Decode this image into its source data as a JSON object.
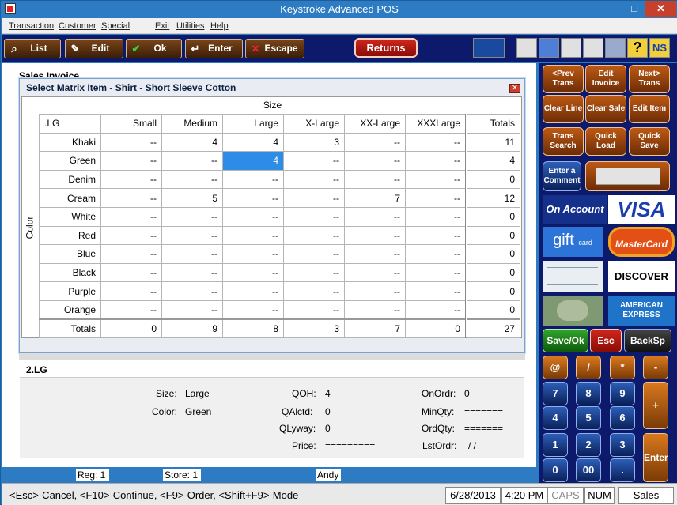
{
  "window": {
    "title": "Keystroke Advanced POS",
    "min": "–",
    "max": "□",
    "close": "✕"
  },
  "menu": [
    "Transaction",
    "Customer",
    "Special",
    "Exit",
    "Utilities",
    "Help"
  ],
  "toolbar": {
    "list": "List",
    "edit": "Edit",
    "ok": "Ok",
    "enter": "Enter",
    "escape": "Escape",
    "returns": "Returns",
    "help": "?",
    "ns": "NS"
  },
  "invoice_label": "Sales Invoice",
  "dialog": {
    "title": "Select Matrix Item - Shirt - Short Sleeve Cotton",
    "close": "✕",
    "size_header": "Size",
    "color_header": "Color",
    "corner": ".LG",
    "columns": [
      "Small",
      "Medium",
      "Large",
      "X-Large",
      "XX-Large",
      "XXXLarge",
      "Totals"
    ],
    "rows": [
      {
        "color": "Khaki",
        "cells": [
          "--",
          "4",
          "4",
          "3",
          "--",
          "--"
        ],
        "total": "11"
      },
      {
        "color": "Green",
        "cells": [
          "--",
          "--",
          "4",
          "--",
          "--",
          "--"
        ],
        "total": "4"
      },
      {
        "color": "Denim",
        "cells": [
          "--",
          "--",
          "--",
          "--",
          "--",
          "--"
        ],
        "total": "0"
      },
      {
        "color": "Cream",
        "cells": [
          "--",
          "5",
          "--",
          "--",
          "7",
          "--"
        ],
        "total": "12"
      },
      {
        "color": "White",
        "cells": [
          "--",
          "--",
          "--",
          "--",
          "--",
          "--"
        ],
        "total": "0"
      },
      {
        "color": "Red",
        "cells": [
          "--",
          "--",
          "--",
          "--",
          "--",
          "--"
        ],
        "total": "0"
      },
      {
        "color": "Blue",
        "cells": [
          "--",
          "--",
          "--",
          "--",
          "--",
          "--"
        ],
        "total": "0"
      },
      {
        "color": "Black",
        "cells": [
          "--",
          "--",
          "--",
          "--",
          "--",
          "--"
        ],
        "total": "0"
      },
      {
        "color": "Purple",
        "cells": [
          "--",
          "--",
          "--",
          "--",
          "--",
          "--"
        ],
        "total": "0"
      },
      {
        "color": "Orange",
        "cells": [
          "--",
          "--",
          "--",
          "--",
          "--",
          "--"
        ],
        "total": "0"
      }
    ],
    "totals_label": "Totals",
    "totals": [
      "0",
      "9",
      "8",
      "3",
      "7",
      "0",
      "27"
    ],
    "selected_cell": {
      "row": "Green",
      "column": "Large"
    }
  },
  "item_code": "2.LG",
  "details": {
    "size_label": "Size:",
    "size": "Large",
    "color_label": "Color:",
    "color": "Green",
    "qoh_label": "QOH:",
    "qoh": "4",
    "qalctd_label": "QAlctd:",
    "qalctd": "0",
    "qlyway_label": "QLyway:",
    "qlyway": "0",
    "price_label": "Price:",
    "price": "=========",
    "onordr_label": "OnOrdr:",
    "onordr": "0",
    "minqty_label": "MinQty:",
    "minqty": "=======",
    "ordqty_label": "OrdQty:",
    "ordqty": "=======",
    "lstordr_label": "LstOrdr:",
    "lstordr": "/ /"
  },
  "statusbar": {
    "reg": "Reg: 1",
    "store": "Store: 1",
    "user": "Andy"
  },
  "hint": "<Esc>-Cancel, <F10>-Continue, <F9>-Order, <Shift+F9>-Mode",
  "hintbar": {
    "date": "6/28/2013",
    "time": "4:20 PM",
    "caps": "CAPS",
    "num": "NUM",
    "mode": "Sales"
  },
  "side_buttons": [
    [
      "<Prev Trans",
      "Edit Invoice",
      "Next> Trans"
    ],
    [
      "Clear Line",
      "Clear Sale",
      "Edit Item"
    ],
    [
      "Trans Search",
      "Quick Load",
      "Quick Save"
    ]
  ],
  "enter_comment": "Enter a Comment",
  "payment": {
    "on_account": "On Account",
    "visa": "VISA",
    "gift": "gift",
    "gift_sub": "card",
    "mastercard": "MasterCard",
    "discover": "DISCOVER",
    "amex": "AMERICAN EXPRESS"
  },
  "keypad": {
    "save_ok": "Save/Ok",
    "esc": "Esc",
    "backsp": "BackSp",
    "ops": [
      "@",
      "/",
      "*",
      "-"
    ],
    "plus": "+",
    "enter": "Enter",
    "digits": [
      "7",
      "8",
      "9",
      "4",
      "5",
      "6",
      "1",
      "2",
      "3",
      "0",
      "00",
      "."
    ]
  },
  "colors": {
    "accent": "#2d7bc3",
    "selected": "#2d8ce6",
    "panel": "#0d1a6b"
  }
}
